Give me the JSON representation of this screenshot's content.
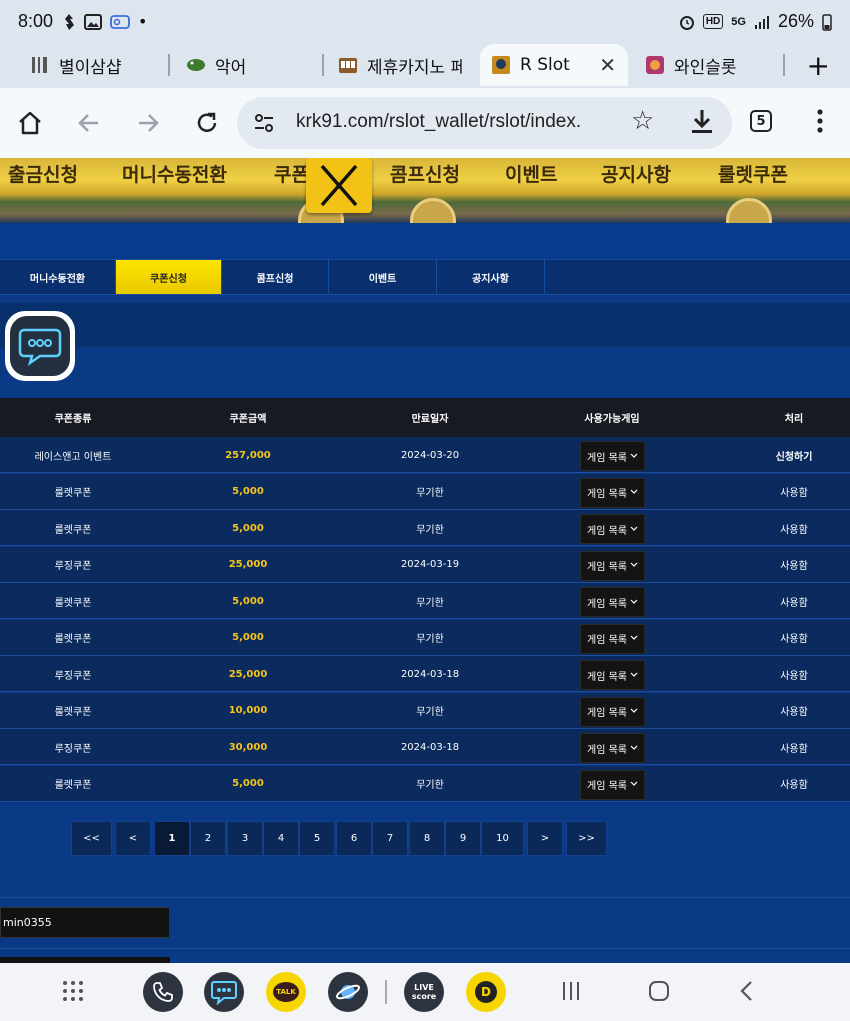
{
  "status_bar": {
    "time": "8:00",
    "battery": "26%",
    "hd": "HD",
    "signal": "5G"
  },
  "browser": {
    "tabs": [
      {
        "title": "별이삼샵",
        "icon_color": "#555555"
      },
      {
        "title": "악어",
        "icon_color": "#3c7a2e"
      },
      {
        "title": "제휴카지노 페",
        "icon_color": "#8b5a2b"
      },
      {
        "title": "R Slot",
        "icon_color": "#c48a1e"
      },
      {
        "title": "와인슬롯",
        "icon_color": "#b03a6e"
      }
    ],
    "url": "krk91.com/rslot_wallet/rslot/index.",
    "tab_count": "5"
  },
  "banner_menu": [
    "출금신청",
    "머니수동전환",
    "쿠폰",
    "콤프신청",
    "이벤트",
    "공지사항",
    "룰렛쿠폰"
  ],
  "subnav": [
    "머니수동전환",
    "쿠폰신청",
    "콤프신청",
    "이벤트",
    "공지사항"
  ],
  "table": {
    "headers": [
      "쿠폰종류",
      "쿠폰금액",
      "만료일자",
      "사용가능게임",
      "처리"
    ],
    "game_select_label": "게임 목록",
    "rows": [
      {
        "type": "레이스앤고 이벤트",
        "amount": "257,000",
        "expiry": "2024-03-20",
        "action": "신청하기"
      },
      {
        "type": "룰렛쿠폰",
        "amount": "5,000",
        "expiry": "무기한",
        "action": "사용함"
      },
      {
        "type": "룰렛쿠폰",
        "amount": "5,000",
        "expiry": "무기한",
        "action": "사용함"
      },
      {
        "type": "루징쿠폰",
        "amount": "25,000",
        "expiry": "2024-03-19",
        "action": "사용함"
      },
      {
        "type": "룰렛쿠폰",
        "amount": "5,000",
        "expiry": "무기한",
        "action": "사용함"
      },
      {
        "type": "룰렛쿠폰",
        "amount": "5,000",
        "expiry": "무기한",
        "action": "사용함"
      },
      {
        "type": "루징쿠폰",
        "amount": "25,000",
        "expiry": "2024-03-18",
        "action": "사용함"
      },
      {
        "type": "룰렛쿠폰",
        "amount": "10,000",
        "expiry": "무기한",
        "action": "사용함"
      },
      {
        "type": "루징쿠폰",
        "amount": "30,000",
        "expiry": "2024-03-18",
        "action": "사용함"
      },
      {
        "type": "룰렛쿠폰",
        "amount": "5,000",
        "expiry": "무기한",
        "action": "사용함"
      }
    ]
  },
  "pagination": {
    "first": "<<",
    "prev": "<",
    "pages": [
      "1",
      "2",
      "3",
      "4",
      "5",
      "6",
      "7",
      "8",
      "9",
      "10"
    ],
    "next": ">",
    "last": ">>",
    "current": "1"
  },
  "user_field": "min0355",
  "bottom_apps": [
    {
      "name": "phone",
      "color": "#2d3440"
    },
    {
      "name": "chat",
      "color": "#2d3440"
    },
    {
      "name": "kakaotalk",
      "label": "TALK",
      "color": "#f7d600"
    },
    {
      "name": "browser",
      "color": "#2d3440"
    },
    {
      "name": "livescore",
      "label": "LIVE score",
      "color": "#2d3440"
    },
    {
      "name": "d-app",
      "label": "D",
      "color": "#f7d600"
    }
  ],
  "colors": {
    "accent_yellow": "#ffe600",
    "amount_gold": "#f5c518",
    "page_bg": "#0a3a86"
  }
}
